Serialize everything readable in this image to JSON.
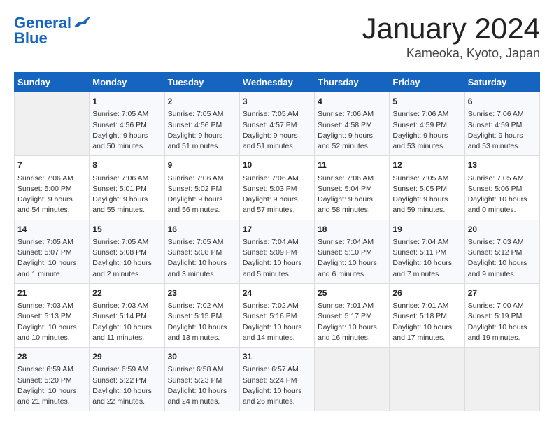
{
  "logo": {
    "line1": "General",
    "line2": "Blue"
  },
  "title": "January 2024",
  "location": "Kameoka, Kyoto, Japan",
  "weekdays": [
    "Sunday",
    "Monday",
    "Tuesday",
    "Wednesday",
    "Thursday",
    "Friday",
    "Saturday"
  ],
  "weeks": [
    [
      {
        "day": "",
        "info": ""
      },
      {
        "day": "1",
        "info": "Sunrise: 7:05 AM\nSunset: 4:56 PM\nDaylight: 9 hours\nand 50 minutes."
      },
      {
        "day": "2",
        "info": "Sunrise: 7:05 AM\nSunset: 4:56 PM\nDaylight: 9 hours\nand 51 minutes."
      },
      {
        "day": "3",
        "info": "Sunrise: 7:05 AM\nSunset: 4:57 PM\nDaylight: 9 hours\nand 51 minutes."
      },
      {
        "day": "4",
        "info": "Sunrise: 7:06 AM\nSunset: 4:58 PM\nDaylight: 9 hours\nand 52 minutes."
      },
      {
        "day": "5",
        "info": "Sunrise: 7:06 AM\nSunset: 4:59 PM\nDaylight: 9 hours\nand 53 minutes."
      },
      {
        "day": "6",
        "info": "Sunrise: 7:06 AM\nSunset: 4:59 PM\nDaylight: 9 hours\nand 53 minutes."
      }
    ],
    [
      {
        "day": "7",
        "info": "Sunrise: 7:06 AM\nSunset: 5:00 PM\nDaylight: 9 hours\nand 54 minutes."
      },
      {
        "day": "8",
        "info": "Sunrise: 7:06 AM\nSunset: 5:01 PM\nDaylight: 9 hours\nand 55 minutes."
      },
      {
        "day": "9",
        "info": "Sunrise: 7:06 AM\nSunset: 5:02 PM\nDaylight: 9 hours\nand 56 minutes."
      },
      {
        "day": "10",
        "info": "Sunrise: 7:06 AM\nSunset: 5:03 PM\nDaylight: 9 hours\nand 57 minutes."
      },
      {
        "day": "11",
        "info": "Sunrise: 7:06 AM\nSunset: 5:04 PM\nDaylight: 9 hours\nand 58 minutes."
      },
      {
        "day": "12",
        "info": "Sunrise: 7:05 AM\nSunset: 5:05 PM\nDaylight: 9 hours\nand 59 minutes."
      },
      {
        "day": "13",
        "info": "Sunrise: 7:05 AM\nSunset: 5:06 PM\nDaylight: 10 hours\nand 0 minutes."
      }
    ],
    [
      {
        "day": "14",
        "info": "Sunrise: 7:05 AM\nSunset: 5:07 PM\nDaylight: 10 hours\nand 1 minute."
      },
      {
        "day": "15",
        "info": "Sunrise: 7:05 AM\nSunset: 5:08 PM\nDaylight: 10 hours\nand 2 minutes."
      },
      {
        "day": "16",
        "info": "Sunrise: 7:05 AM\nSunset: 5:08 PM\nDaylight: 10 hours\nand 3 minutes."
      },
      {
        "day": "17",
        "info": "Sunrise: 7:04 AM\nSunset: 5:09 PM\nDaylight: 10 hours\nand 5 minutes."
      },
      {
        "day": "18",
        "info": "Sunrise: 7:04 AM\nSunset: 5:10 PM\nDaylight: 10 hours\nand 6 minutes."
      },
      {
        "day": "19",
        "info": "Sunrise: 7:04 AM\nSunset: 5:11 PM\nDaylight: 10 hours\nand 7 minutes."
      },
      {
        "day": "20",
        "info": "Sunrise: 7:03 AM\nSunset: 5:12 PM\nDaylight: 10 hours\nand 9 minutes."
      }
    ],
    [
      {
        "day": "21",
        "info": "Sunrise: 7:03 AM\nSunset: 5:13 PM\nDaylight: 10 hours\nand 10 minutes."
      },
      {
        "day": "22",
        "info": "Sunrise: 7:03 AM\nSunset: 5:14 PM\nDaylight: 10 hours\nand 11 minutes."
      },
      {
        "day": "23",
        "info": "Sunrise: 7:02 AM\nSunset: 5:15 PM\nDaylight: 10 hours\nand 13 minutes."
      },
      {
        "day": "24",
        "info": "Sunrise: 7:02 AM\nSunset: 5:16 PM\nDaylight: 10 hours\nand 14 minutes."
      },
      {
        "day": "25",
        "info": "Sunrise: 7:01 AM\nSunset: 5:17 PM\nDaylight: 10 hours\nand 16 minutes."
      },
      {
        "day": "26",
        "info": "Sunrise: 7:01 AM\nSunset: 5:18 PM\nDaylight: 10 hours\nand 17 minutes."
      },
      {
        "day": "27",
        "info": "Sunrise: 7:00 AM\nSunset: 5:19 PM\nDaylight: 10 hours\nand 19 minutes."
      }
    ],
    [
      {
        "day": "28",
        "info": "Sunrise: 6:59 AM\nSunset: 5:20 PM\nDaylight: 10 hours\nand 21 minutes."
      },
      {
        "day": "29",
        "info": "Sunrise: 6:59 AM\nSunset: 5:22 PM\nDaylight: 10 hours\nand 22 minutes."
      },
      {
        "day": "30",
        "info": "Sunrise: 6:58 AM\nSunset: 5:23 PM\nDaylight: 10 hours\nand 24 minutes."
      },
      {
        "day": "31",
        "info": "Sunrise: 6:57 AM\nSunset: 5:24 PM\nDaylight: 10 hours\nand 26 minutes."
      },
      {
        "day": "",
        "info": ""
      },
      {
        "day": "",
        "info": ""
      },
      {
        "day": "",
        "info": ""
      }
    ]
  ]
}
